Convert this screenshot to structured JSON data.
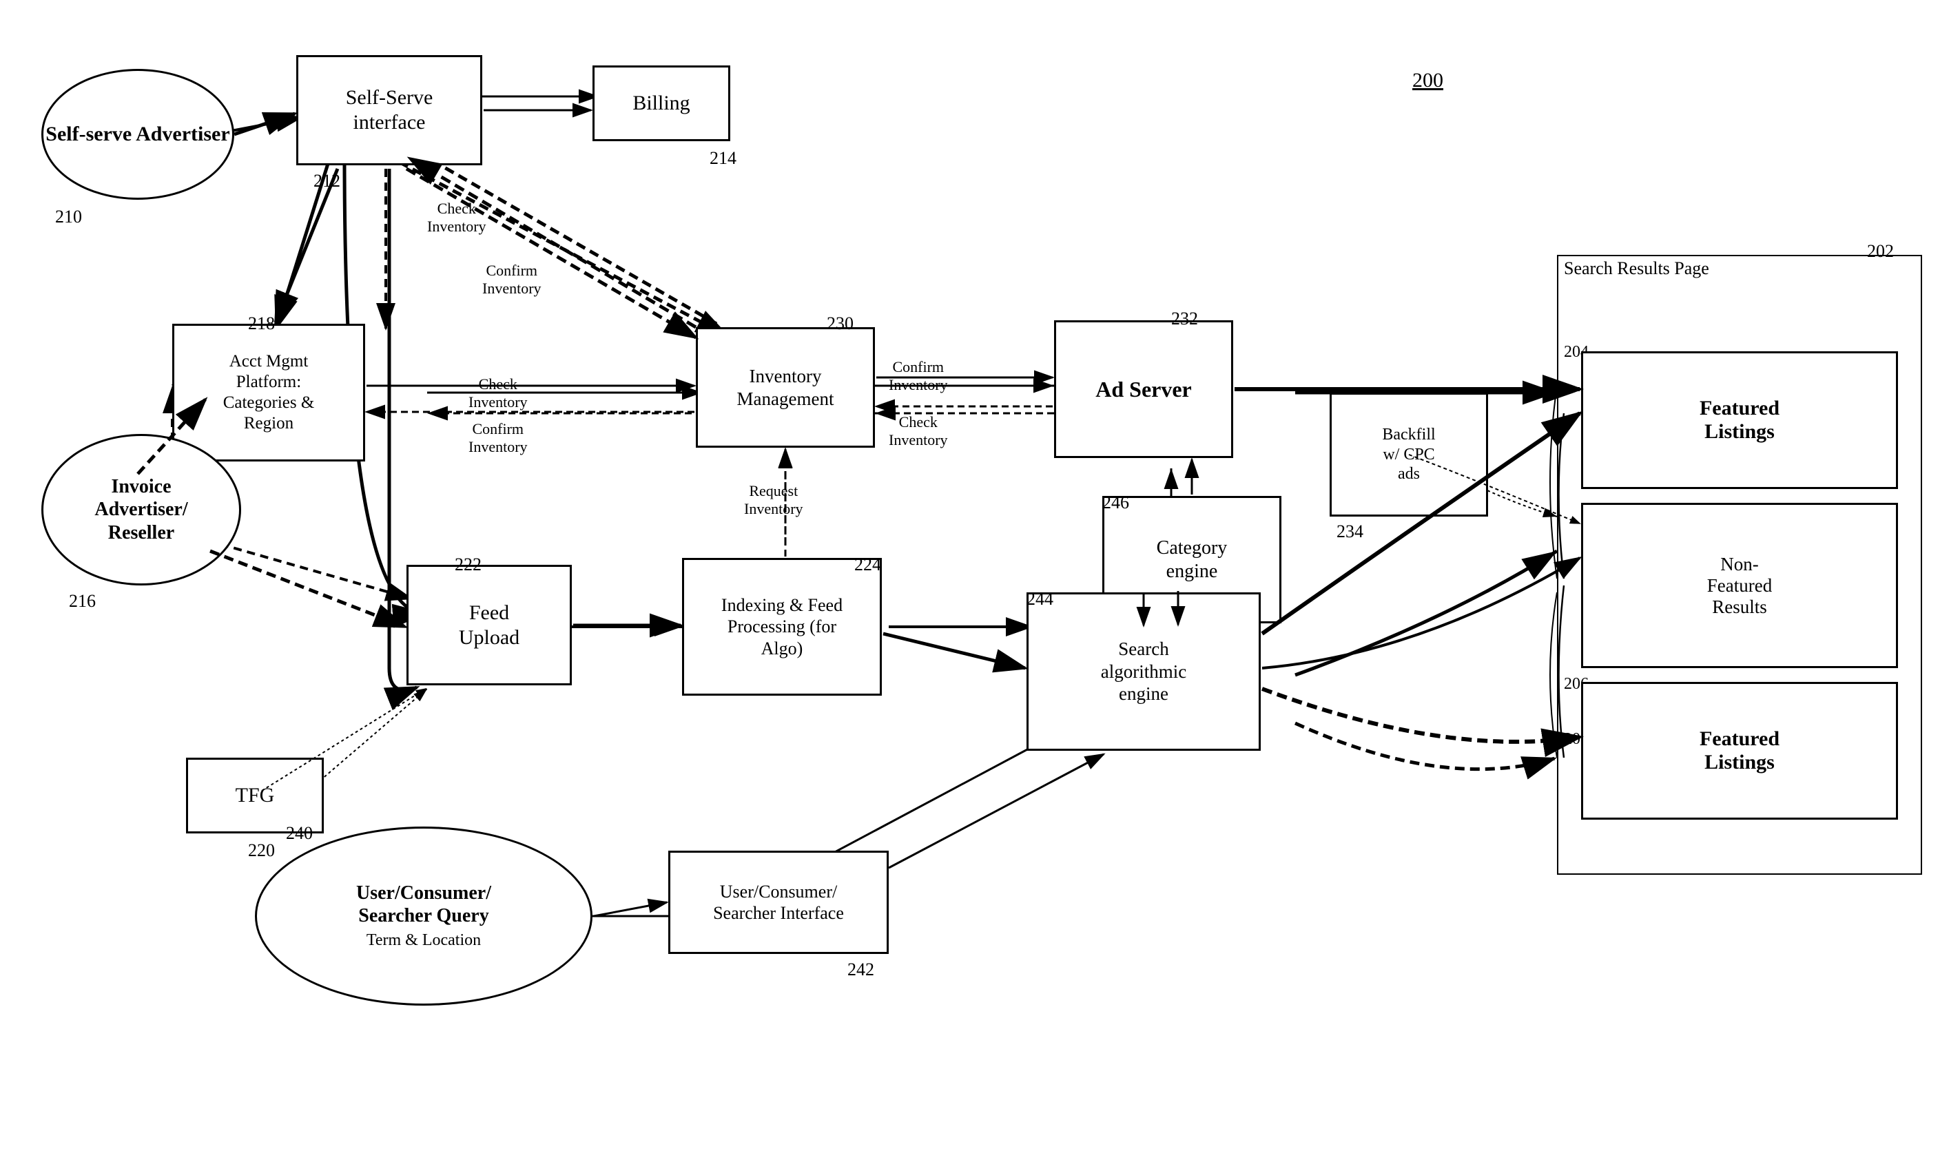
{
  "diagram": {
    "title": "200",
    "nodes": {
      "self_serve_advertiser": {
        "label": "Self-serve\nAdvertiser",
        "id": "210",
        "type": "ellipse"
      },
      "self_serve_interface": {
        "label": "Self-Serve\ninterface",
        "id": "212",
        "type": "box"
      },
      "billing": {
        "label": "Billing",
        "id": "214",
        "type": "box"
      },
      "invoice_advertiser": {
        "label": "Invoice\nAdvertiser/\nReseller",
        "id": "216",
        "type": "ellipse"
      },
      "acct_mgmt_platform": {
        "label": "Acct Mgmt\nPlatform:\nCategories &\nRegion",
        "id": "218",
        "type": "box"
      },
      "tfg": {
        "label": "TFG",
        "id": "220",
        "type": "box"
      },
      "feed_upload": {
        "label": "Feed\nUpload",
        "id": "222",
        "type": "box"
      },
      "indexing_feed": {
        "label": "Indexing & Feed\nProcessing (for\nAlgo)",
        "id": "224",
        "type": "box"
      },
      "inventory_management": {
        "label": "Inventory\nManagement",
        "id": "230",
        "type": "box"
      },
      "ad_server": {
        "label": "Ad Server",
        "id": "232",
        "type": "box"
      },
      "backfill_cpc": {
        "label": "Backfill\nw/ CPC\nads",
        "id": "234",
        "type": "box"
      },
      "category_engine": {
        "label": "Category\nengine",
        "id": "246",
        "type": "box"
      },
      "search_algorithmic": {
        "label": "Search\nalgorithmic\nengine",
        "id": "244",
        "type": "box"
      },
      "user_consumer_query": {
        "label": "User/Consumer/\nSearcher Query\nTerm & Location",
        "id": "240",
        "type": "ellipse"
      },
      "user_consumer_interface": {
        "label": "User/Consumer/\nSearcher Interface",
        "id": "242",
        "type": "box"
      },
      "search_results_page": {
        "label": "Search Results Page",
        "id": "202",
        "type": "page"
      },
      "featured_listings_top": {
        "label": "Featured\nListings",
        "id": "204",
        "type": "featured"
      },
      "non_featured_results": {
        "label": "Non-\nFeatured\nResults",
        "id": "206",
        "type": "non-featured"
      },
      "featured_listings_bottom": {
        "label": "Featured\nListings",
        "id": "208",
        "type": "featured"
      }
    },
    "arrow_labels": {
      "check_inventory_1": "Check\nInventory",
      "confirm_inventory_1": "Confirm\nInventory",
      "check_inventory_2": "Check\nInventory",
      "confirm_inventory_2": "Confirm\nInventory",
      "request_inventory": "Request\nInventory",
      "check_inventory_3": "Check\nInventory",
      "confirm_inventory_3": "Confirm\nInventory"
    }
  }
}
